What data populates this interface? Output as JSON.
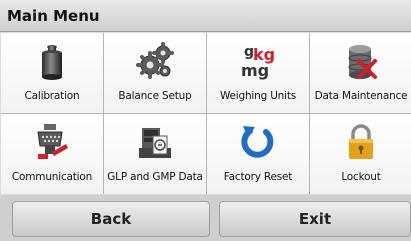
{
  "header": {
    "title": "Main Menu"
  },
  "menu": {
    "items": [
      {
        "label": "Calibration",
        "icon": "calibration-weight-icon"
      },
      {
        "label": "Balance Setup",
        "icon": "gears-icon"
      },
      {
        "label": "Weighing Units",
        "icon": "units-icon"
      },
      {
        "label": "Data Maintenance",
        "icon": "database-tools-icon"
      },
      {
        "label": "Communication",
        "icon": "serial-connector-icon"
      },
      {
        "label": "GLP and GMP Data",
        "icon": "document-printer-icon"
      },
      {
        "label": "Factory Reset",
        "icon": "reset-arrow-icon"
      },
      {
        "label": "Lockout",
        "icon": "padlock-icon"
      }
    ]
  },
  "units_icon_text": {
    "g": "g",
    "kg": "kg",
    "mg": "mg"
  },
  "footer": {
    "back_label": "Back",
    "exit_label": "Exit"
  },
  "colors": {
    "accent_red": "#d0202a",
    "reset_blue": "#1f6ec2",
    "lock_gold": "#e3a21a"
  }
}
